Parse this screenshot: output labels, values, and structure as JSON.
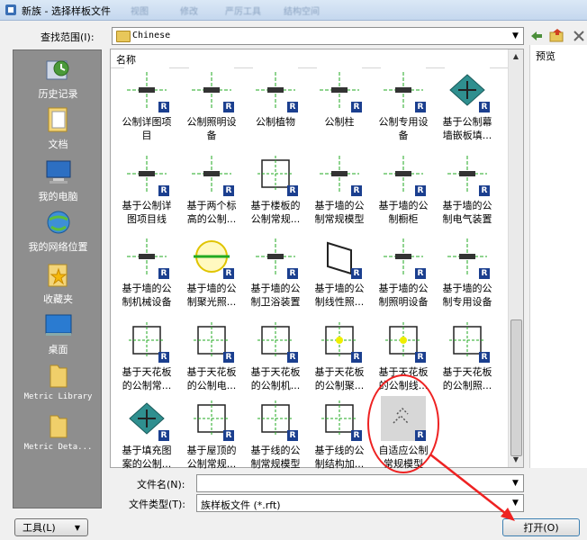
{
  "window": {
    "title": "新族 - 选择样板文件",
    "ghost_menu": [
      "视图",
      "修改",
      "严厉工具",
      "结构空间"
    ]
  },
  "lookin": {
    "label": "查找范围(I):",
    "value": "Chinese"
  },
  "places": [
    {
      "label": "历史记录",
      "icon": "history-icon"
    },
    {
      "label": "文档",
      "icon": "documents-icon"
    },
    {
      "label": "我的电脑",
      "icon": "computer-icon"
    },
    {
      "label": "我的网络位置",
      "icon": "network-icon"
    },
    {
      "label": "收藏夹",
      "icon": "favorites-icon"
    },
    {
      "label": "桌面",
      "icon": "desktop-icon"
    },
    {
      "label": "Metric Library",
      "icon": "folder-icon"
    },
    {
      "label": "Metric Deta...",
      "icon": "folder-icon"
    }
  ],
  "list": {
    "column_header": "名称",
    "rows": [
      [
        "公制详图项\n目",
        "公制照明设\n备",
        "公制植物",
        "公制柱",
        "公制专用设\n备",
        "基于公制幕\n墙嵌板填..."
      ],
      [
        "基于公制详\n图项目线",
        "基于两个标\n高的公制...",
        "基于楼板的\n公制常规...",
        "基于墙的公\n制常规模型",
        "基于墙的公\n制橱柜",
        "基于墙的公\n制电气装置"
      ],
      [
        "基于墙的公\n制机械设备",
        "基于墙的公\n制聚光照...",
        "基于墙的公\n制卫浴装置",
        "基于墙的公\n制线性照...",
        "基于墙的公\n制照明设备",
        "基于墙的公\n制专用设备"
      ],
      [
        "基于天花板\n的公制常...",
        "基于天花板\n的公制电...",
        "基于天花板\n的公制机...",
        "基于天花板\n的公制聚...",
        "基于天花板\n的公制线...",
        "基于天花板\n的公制照..."
      ],
      [
        "基于填充图\n案的公制...",
        "基于屋顶的\n公制常规...",
        "基于线的公\n制常规模型",
        "基于线的公\n制结构加...",
        "自适应公制\n常规模型"
      ]
    ]
  },
  "preview_label": "预览",
  "filename": {
    "label": "文件名(N):",
    "value": ""
  },
  "filetype": {
    "label": "文件类型(T):",
    "value": "族样板文件 (*.rft)"
  },
  "buttons": {
    "tools": "工具(L)",
    "open": "打开(O)"
  },
  "highlight_color": "#e02020"
}
